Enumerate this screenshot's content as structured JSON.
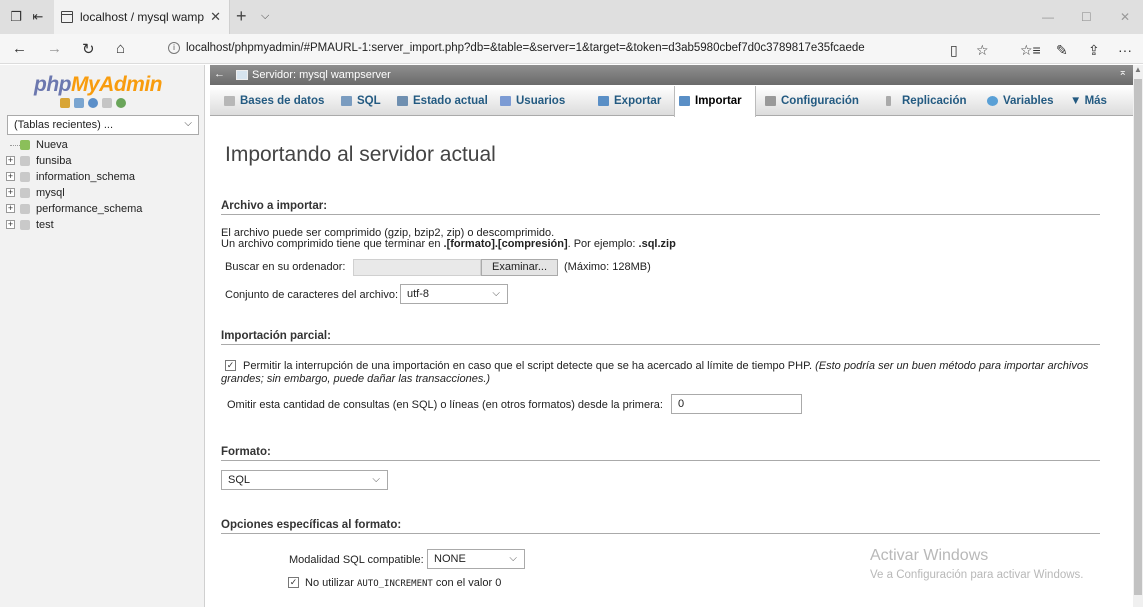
{
  "browser": {
    "tab_title": "localhost / mysql wamp",
    "tab_close": "✕",
    "new_tab": "+",
    "tab_menu": "⌵",
    "url": "localhost/phpmyadmin/#PMAURL-1:server_import.php?db=&table=&server=1&target=&token=d3ab5980cbef7d0c3789817e35fcaede",
    "nav": {
      "back": "←",
      "forward": "→",
      "refresh": "↻",
      "home": "⌂"
    },
    "window": {
      "minimize": "—",
      "maximize": "☐",
      "close": "✕"
    },
    "right_icons": {
      "reading": "▯",
      "favorite": "☆",
      "favorites_hub": "☆≡",
      "notes": "✎",
      "share": "⇪",
      "more": "···"
    }
  },
  "sidebar": {
    "logo_php": "php",
    "logo_myadmin": "MyAdmin",
    "recent_select": "(Tablas recientes) ...",
    "items": [
      {
        "label": "Nueva"
      },
      {
        "label": "funsiba"
      },
      {
        "label": "information_schema"
      },
      {
        "label": "mysql"
      },
      {
        "label": "performance_schema"
      },
      {
        "label": "test"
      }
    ]
  },
  "serverbar": {
    "back": "←",
    "label": "Servidor: mysql wampserver",
    "collapse": "⌅"
  },
  "menu": {
    "items": [
      {
        "label": "Bases de datos",
        "icon_color": "#b7b7b7"
      },
      {
        "label": "SQL",
        "icon_color": "#7a9cc0"
      },
      {
        "label": "Estado actual",
        "icon_color": "#6f8fb0"
      },
      {
        "label": "Usuarios",
        "icon_color": "#7c9bd4"
      },
      {
        "label": "Exportar",
        "icon_color": "#5a8fc6"
      },
      {
        "label": "Importar",
        "icon_color": "#5a8fc6"
      },
      {
        "label": "Configuración",
        "icon_color": "#999999"
      },
      {
        "label": "Replicación",
        "icon_color": "#aaaaaa"
      },
      {
        "label": "Variables",
        "icon_color": "#5aa0d6"
      },
      {
        "label": "▼ Más",
        "icon_color": ""
      }
    ],
    "active_index": 5
  },
  "main": {
    "title": "Importando al servidor actual",
    "section_file": "Archivo a importar:",
    "file_desc1": "El archivo puede ser comprimido (gzip, bzip2, zip) o descomprimido.",
    "file_desc2_pre": "Un archivo comprimido tiene que terminar en ",
    "file_desc2_b1": ".[formato].[compresión]",
    "file_desc2_mid": ". Por ejemplo: ",
    "file_desc2_b2": ".sql.zip",
    "browse_label": "Buscar en su ordenador:",
    "browse_button": "Examinar...",
    "max_size": "(Máximo: 128MB)",
    "charset_label": "Conjunto de caracteres del archivo:",
    "charset_value": "utf-8",
    "section_partial": "Importación parcial:",
    "partial_checkbox_label": "Permitir la interrupción de una importación en caso que el script detecte que se ha acercado al límite de tiempo PHP.",
    "partial_note1": "(Esto podría ser un buen método para importar archivos",
    "partial_note2": "grandes; sin embargo, puede dañar las transacciones.)",
    "skip_label": "Omitir esta cantidad de consultas (en SQL) o líneas (en otros formatos) desde la primera:",
    "skip_value": "0",
    "section_format": "Formato:",
    "format_value": "SQL",
    "section_format_options": "Opciones específicas al formato:",
    "sql_compat_label": "Modalidad SQL compatible:",
    "sql_compat_value": "NONE",
    "no_auto_inc_pre": "No utilizar ",
    "no_auto_inc_code": "AUTO_INCREMENT",
    "no_auto_inc_post": " con el valor 0",
    "check_mark": "✓",
    "select_arrow": "⌵"
  },
  "watermark": {
    "line1": "Activar Windows",
    "line2": "Ve a Configuración para activar Windows."
  }
}
